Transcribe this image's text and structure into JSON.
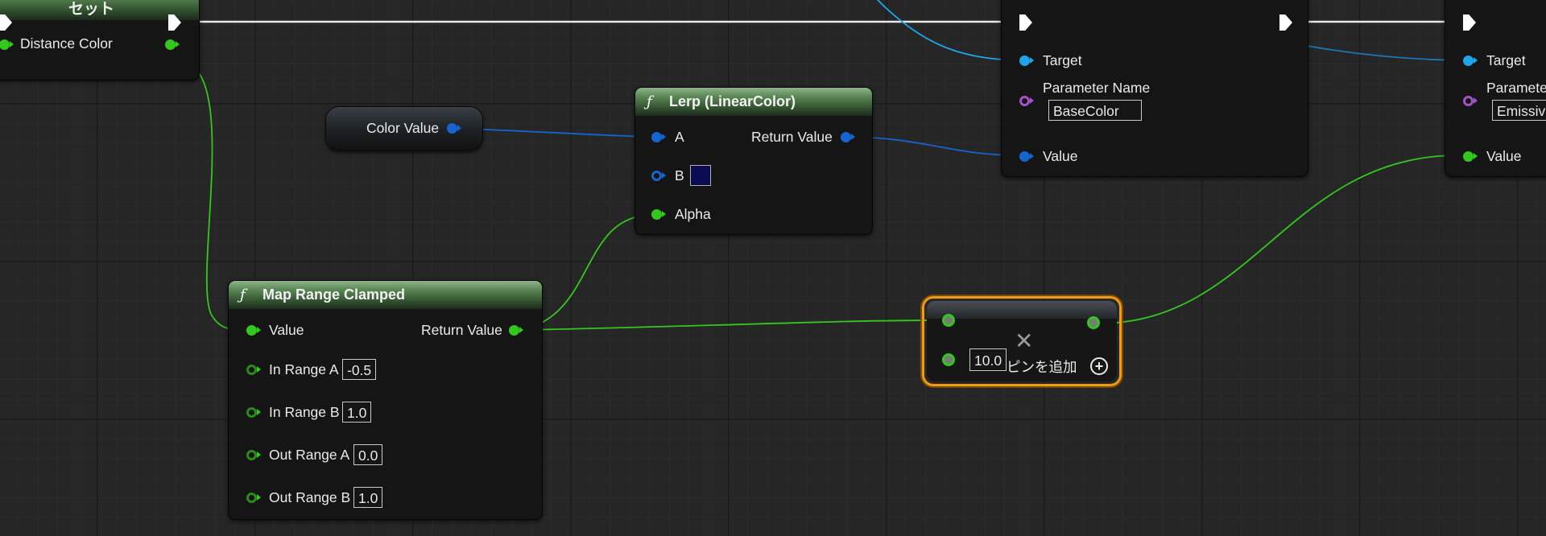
{
  "set_node": {
    "title": "セット",
    "pin_label": "Distance Color"
  },
  "color_value_node": {
    "label": "Color Value"
  },
  "lerp_node": {
    "title": "Lerp (LinearColor)",
    "pin_a": "A",
    "pin_b": "B",
    "pin_alpha": "Alpha",
    "return_value": "Return Value",
    "b_swatch_color": "#0b0c52"
  },
  "map_range_node": {
    "title": "Map Range Clamped",
    "pin_value": "Value",
    "return_value": "Return Value",
    "in_range_a": {
      "label": "In Range A",
      "value": "-0.5"
    },
    "in_range_b": {
      "label": "In Range B",
      "value": "1.0"
    },
    "out_range_a": {
      "label": "Out Range A",
      "value": "0.0"
    },
    "out_range_b": {
      "label": "Out Range B",
      "value": "1.0"
    }
  },
  "multiply_node": {
    "input_value": "10.0",
    "add_pin_label": "ピンを追加",
    "operator_icon": "multiply-icon"
  },
  "set_param_node_1": {
    "target": "Target",
    "parameter_name_label": "Parameter Name",
    "parameter_name_value": "BaseColor",
    "value_label": "Value"
  },
  "set_param_node_2": {
    "target": "Target",
    "parameter_name_label": "Parameter Name",
    "parameter_name_value": "Emissive",
    "value_label": "Value"
  },
  "colors": {
    "float_pin": "#33c81e",
    "linear_color_pin": "#1564d0",
    "object_pin": "#1ea6e8",
    "name_pin": "#a054c8",
    "exec_wire": "#ffffff",
    "selection": "#f29a12"
  }
}
